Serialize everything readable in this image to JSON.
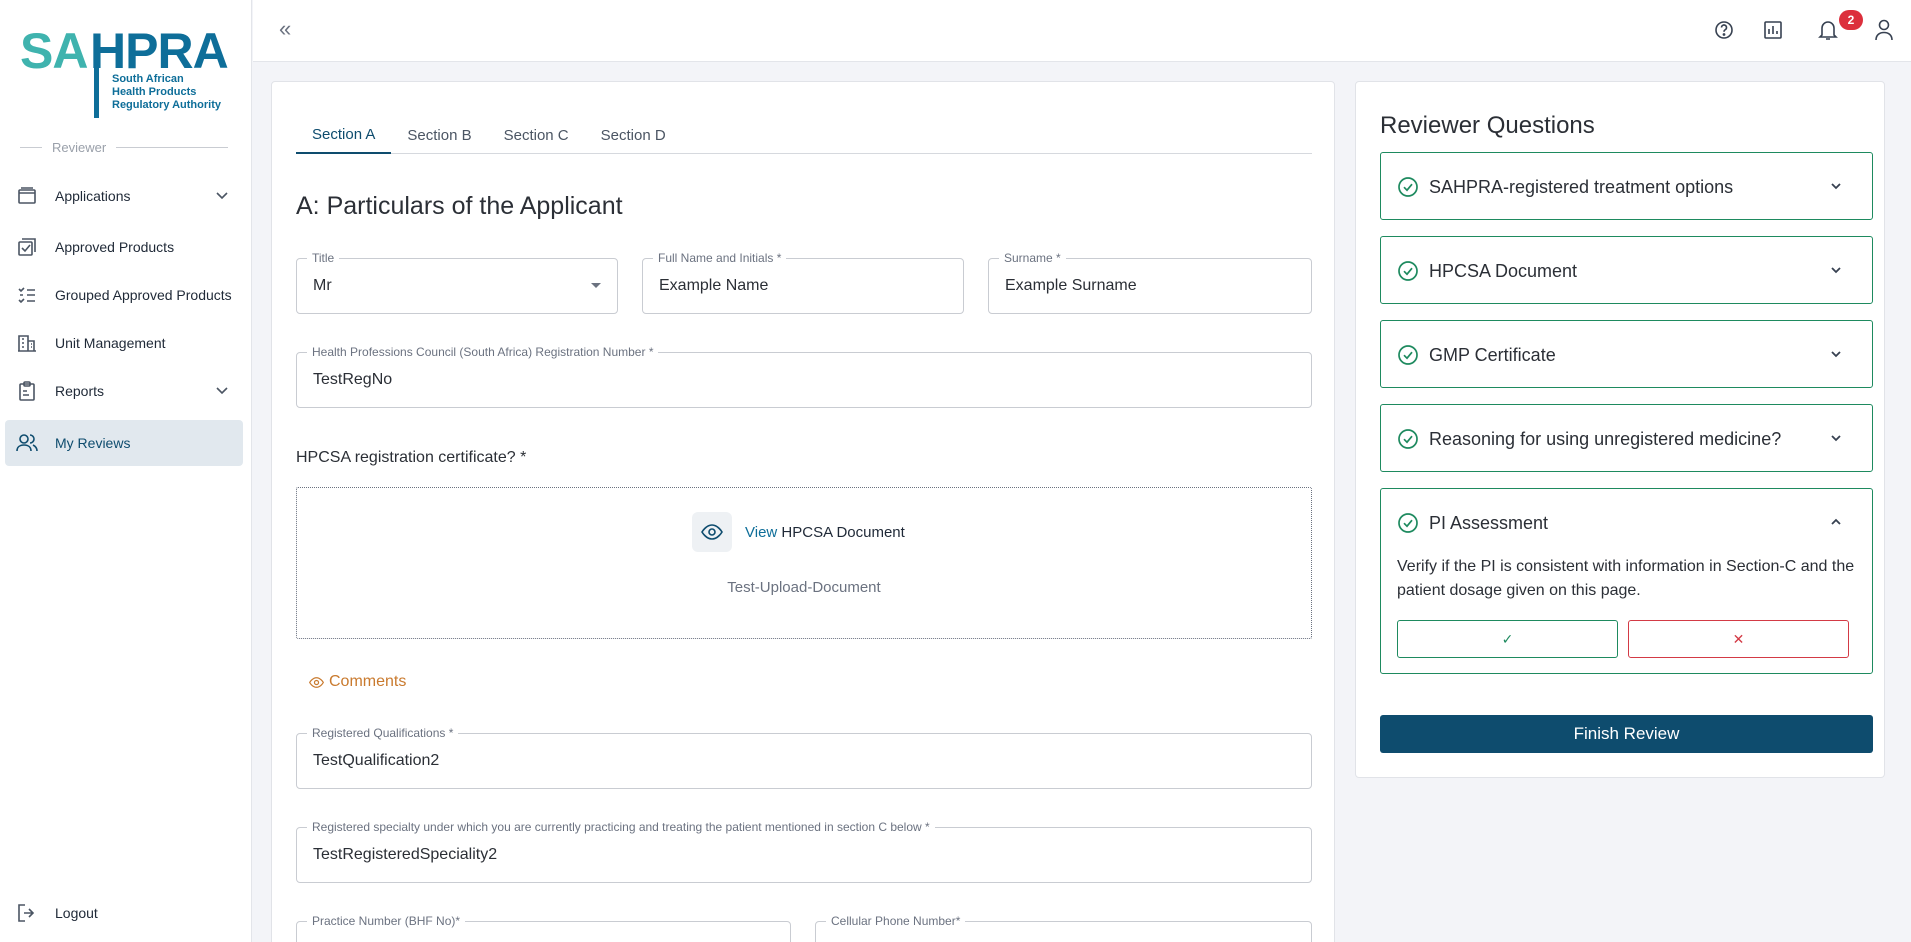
{
  "logo": {
    "part1": "SA",
    "part2": "HPRA",
    "subtitle": [
      "South African",
      "Health Products",
      "Regulatory Authority"
    ]
  },
  "sidebar": {
    "role": "Reviewer",
    "items": [
      {
        "label": "Applications",
        "icon": "applications-icon",
        "expandable": true
      },
      {
        "label": "Approved Products",
        "icon": "approved-icon"
      },
      {
        "label": "Grouped Approved Products",
        "icon": "list-check-icon"
      },
      {
        "label": "Unit Management",
        "icon": "building-icon"
      },
      {
        "label": "Reports",
        "icon": "clipboard-icon",
        "expandable": true
      },
      {
        "label": "My Reviews",
        "icon": "users-icon",
        "active": true
      }
    ],
    "logout": "Logout"
  },
  "topbar": {
    "collapse": "«",
    "notifications_count": "2"
  },
  "tabs": [
    "Section A",
    "Section B",
    "Section C",
    "Section D"
  ],
  "section": {
    "title": "A: Particulars of the Applicant",
    "fields": {
      "title": {
        "label": "Title",
        "value": "Mr"
      },
      "full_name": {
        "label": "Full Name and Initials *",
        "value": "Example Name"
      },
      "surname": {
        "label": "Surname *",
        "value": "Example Surname"
      },
      "hpcsa_reg": {
        "label": "Health Professions Council (South Africa) Registration Number *",
        "value": "TestRegNo"
      },
      "qualifications": {
        "label": "Registered Qualifications *",
        "value": "TestQualification2"
      },
      "specialty": {
        "label": "Registered specialty under which you are currently practicing and treating the patient mentioned in section C below *",
        "value": "TestRegisteredSpeciality2"
      },
      "practice_number": {
        "label": "Practice Number (BHF No)*",
        "value": ""
      },
      "cellular": {
        "label": "Cellular Phone Number*",
        "value": ""
      }
    },
    "certificate_label": "HPCSA registration certificate? *",
    "upload": {
      "view": "View",
      "document": "HPCSA Document",
      "file_name": "Test-Upload-Document"
    },
    "comments": "Comments"
  },
  "review": {
    "title": "Reviewer Questions",
    "questions": [
      {
        "title": "SAHPRA-registered treatment options",
        "expanded": false
      },
      {
        "title": "HPCSA Document",
        "expanded": false
      },
      {
        "title": "GMP Certificate",
        "expanded": false
      },
      {
        "title": "Reasoning for using unregistered medicine?",
        "expanded": false
      },
      {
        "title": "PI Assessment",
        "expanded": true,
        "text": "Verify if the PI is consistent with information in Section-C and the patient dosage given on this page."
      }
    ],
    "yes": "✓",
    "no": "✕",
    "finish": "Finish Review"
  },
  "colors": {
    "primary": "#0e4c6e",
    "success": "#1e8a5f",
    "danger": "#d33a45",
    "accent": "#c97a2e",
    "logo_teal": "#3fb3ae",
    "logo_blue": "#0e6e99"
  }
}
